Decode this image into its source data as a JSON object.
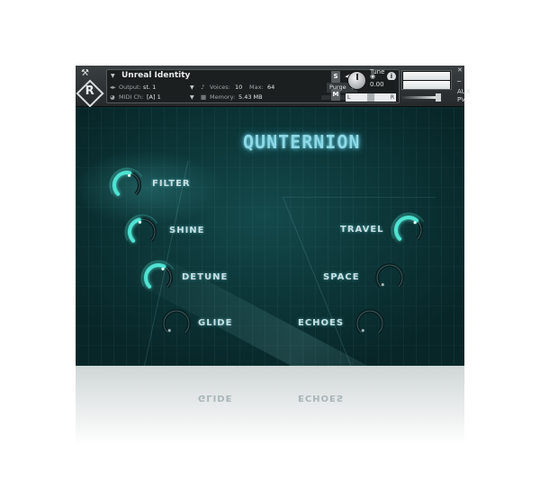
{
  "header": {
    "instrument_name": "Unreal Identity",
    "output_label": "Output:",
    "output_value": "st. 1",
    "voices_label": "Voices:",
    "voices_value": "10",
    "max_label": "Max:",
    "max_value": "64",
    "purge_label": "Purge",
    "midi_label": "MIDI Ch:",
    "midi_value": "[A]  1",
    "memory_label": "Memory:",
    "memory_value": "5.43 MB",
    "s_button": "S",
    "m_button": "M",
    "tune_label": "Tune",
    "tune_value": "0.00",
    "pan_left": "L",
    "pan_right": "R",
    "aux_label": "AUX",
    "pv_label": "PV"
  },
  "panel": {
    "product_title": "QUNTERNION",
    "knobs": [
      {
        "id": "filter",
        "label": "FILTER",
        "level": 0.55,
        "active": true
      },
      {
        "id": "shine",
        "label": "SHINE",
        "level": 0.45,
        "active": true
      },
      {
        "id": "detune",
        "label": "DETUNE",
        "level": 0.6,
        "active": true
      },
      {
        "id": "glide",
        "label": "GLIDE",
        "level": 0.0,
        "active": false
      },
      {
        "id": "travel",
        "label": "TRAVEL",
        "level": 0.65,
        "active": true
      },
      {
        "id": "space",
        "label": "SPACE",
        "level": 0.0,
        "active": false
      },
      {
        "id": "echoes",
        "label": "ECHOES",
        "level": 0.0,
        "active": false
      }
    ]
  },
  "reflection": {
    "glide_label": "GLIDE",
    "echoes_label": "ECHOES"
  },
  "colors": {
    "accent": "#4fe3d2",
    "panel_dark": "#0b3133",
    "label": "#c9dfe2"
  }
}
